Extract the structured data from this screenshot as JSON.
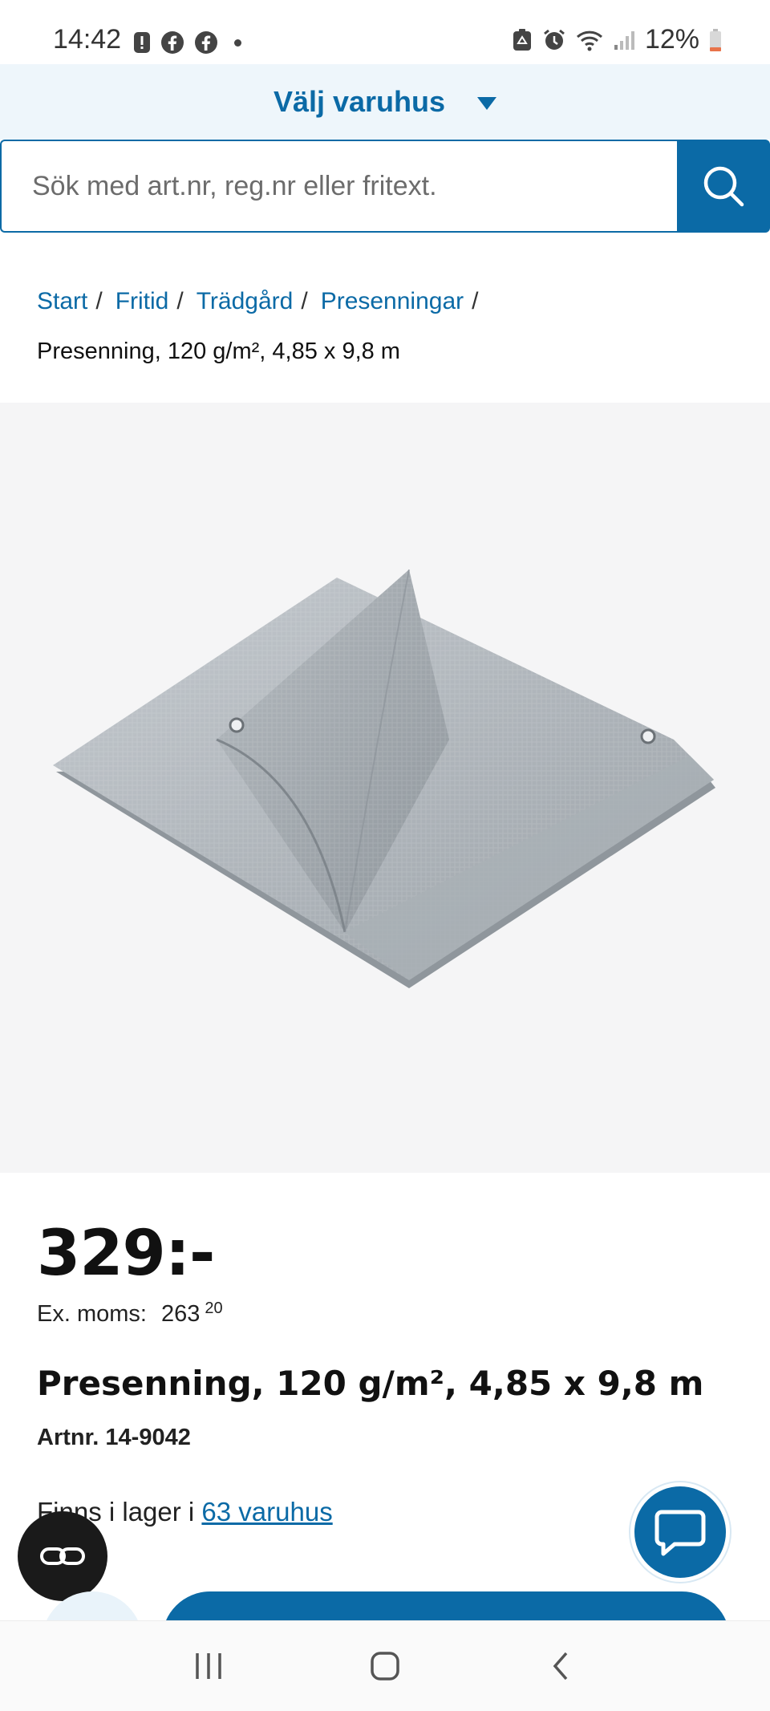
{
  "status_bar": {
    "time": "14:42",
    "battery": "12%",
    "icons_left": [
      "notification-icon",
      "facebook-icon",
      "facebook-icon",
      "dot-icon"
    ],
    "icons_right": [
      "recycle-icon",
      "alarm-icon",
      "wifi-icon",
      "signal-icon",
      "battery-icon"
    ]
  },
  "store_selector": {
    "label": "Välj varuhus"
  },
  "search": {
    "placeholder": "Sök med art.nr, reg.nr eller fritext.",
    "icon": "search-icon"
  },
  "breadcrumb": {
    "items": [
      "Start",
      "Fritid",
      "Trädgård",
      "Presenningar"
    ],
    "separator": "/",
    "current": "Presenning, 120 g/m², 4,85 x 9,8 m"
  },
  "product": {
    "price": "329:-",
    "ex_moms_label": "Ex. moms:",
    "ex_moms_value": "263",
    "ex_moms_decimals": "20",
    "title": "Presenning, 120 g/m², 4,85 x 9,8 m",
    "artnr": "Artnr. 14-9042",
    "stock_prefix": "Finns i lager i ",
    "stock_link": "63 varuhus"
  },
  "colors": {
    "brand_blue": "#0b6aa6",
    "store_bar_bg": "#eef6fb",
    "image_bg": "#f5f5f6"
  },
  "nav": {
    "icons": [
      "recent-apps-icon",
      "home-icon",
      "back-icon"
    ]
  }
}
